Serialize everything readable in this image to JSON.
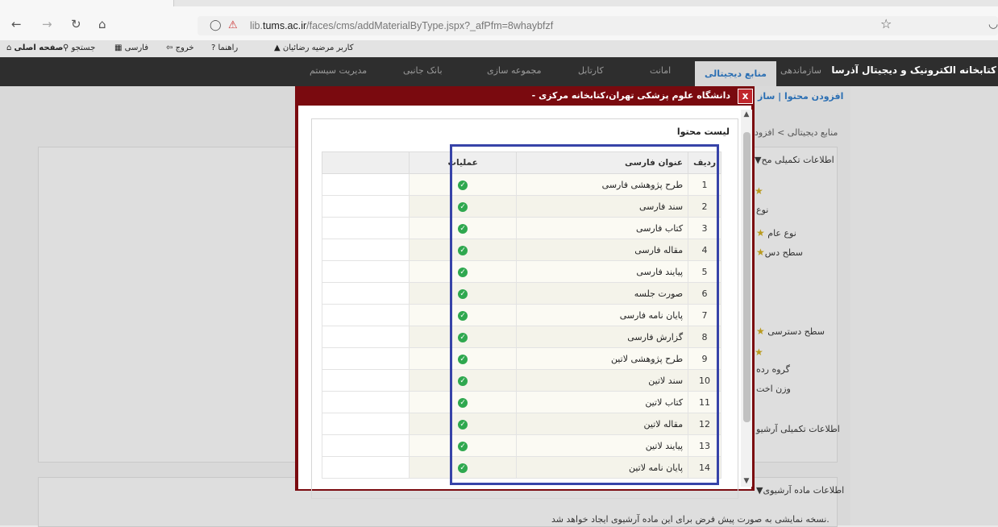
{
  "browser": {
    "url_prefix": "lib.",
    "url_domain": "tums.ac.ir",
    "url_path": "/faces/cms/addMaterialByType.jspx?_afPfm=8whaybfzf"
  },
  "userbar": {
    "home": "صفحه اصلی",
    "search": "جستجو",
    "language": "فارسی",
    "logout": "خروج",
    "help": "راهنما",
    "user": "کاربر مرضیه رضائیان"
  },
  "topnav": {
    "brand": "کتابخانه الکترونیک و دیجیتال آذرسا",
    "items": [
      "سازماندهی",
      "منابع دیجیتالی",
      "امانت",
      "کارتابل",
      "مجموعه سازی",
      "بانک جانبی",
      "مدیریت سیستم"
    ],
    "active_index": 1
  },
  "page": {
    "subnav": "افزودن محتوا | ساز",
    "breadcrumb": "منابع دیجیتالی > افزود",
    "section1": "▼اطلاعات تکمیلی مح",
    "f_type": "نوع",
    "f_general_type": "نوع عام",
    "f_access": "سطح دس",
    "f_access_level": "سطح دسترسی",
    "f_group": "گروه رده",
    "f_weight": "وزن اخت",
    "f_archive_extra": "اطلاعات تکمیلی آرشیو",
    "section2": "▼اطلاعات ماده آرشیوی",
    "notice": "نسخه نمایشی به صورت پیش فرض برای این ماده آرشیوی ایجاد خواهد شد."
  },
  "modal": {
    "title": "- دانشگاه علوم پزشکی تهران،کتابخانه مرکزی",
    "close": "x",
    "panel_title": "لیست محتوا",
    "columns": {
      "row": "ردیف",
      "title": "عنوان فارسی",
      "ops": "عملیات"
    },
    "rows": [
      {
        "n": "1",
        "title": "طرح پژوهشی فارسی"
      },
      {
        "n": "2",
        "title": "سند فارسی"
      },
      {
        "n": "3",
        "title": "کتاب فارسی"
      },
      {
        "n": "4",
        "title": "مقاله فارسی"
      },
      {
        "n": "5",
        "title": "پیایند فارسی"
      },
      {
        "n": "6",
        "title": "صورت جلسه"
      },
      {
        "n": "7",
        "title": "پایان نامه فارسی"
      },
      {
        "n": "8",
        "title": "گزارش فارسی"
      },
      {
        "n": "9",
        "title": "طرح پژوهشی لاتین"
      },
      {
        "n": "10",
        "title": "سند لاتین"
      },
      {
        "n": "11",
        "title": "کتاب لاتین"
      },
      {
        "n": "12",
        "title": "مقاله لاتین"
      },
      {
        "n": "13",
        "title": "پیایند لاتین"
      },
      {
        "n": "14",
        "title": "پایان نامه لاتین"
      }
    ]
  },
  "colors": {
    "modal_header": "#7a0a0f",
    "highlight": "#3743a8",
    "check": "#2fa84f"
  },
  "icons": [
    "back-icon",
    "forward-icon",
    "reload-icon",
    "home-icon",
    "shield-icon",
    "lock-icon",
    "bookmark-star-icon",
    "check-icon",
    "close-icon"
  ]
}
